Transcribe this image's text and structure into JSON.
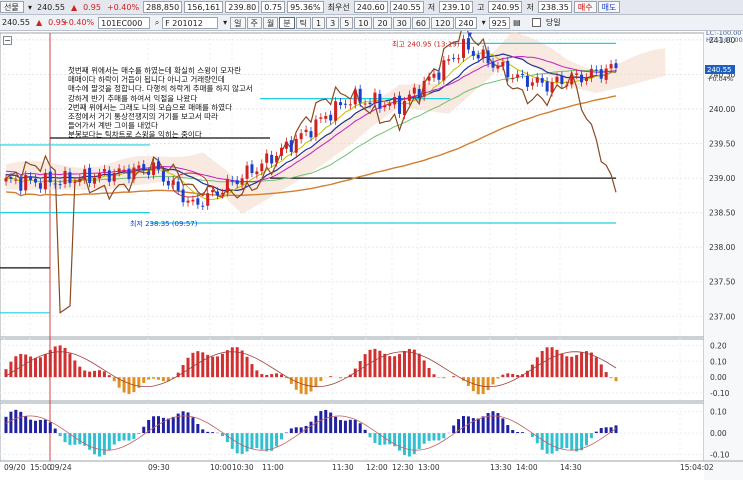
{
  "toolbar1": {
    "mode": "선물",
    "price": "240.55",
    "change_arrow": "▲",
    "change": "0.95",
    "change_pct": "+0.40%",
    "prev_close": "288,850",
    "volume": "156,161",
    "value1": "239.80",
    "value2": "0.75",
    "value3": "95.36%",
    "label_best": "최우선",
    "bid": "240.60",
    "ask": "240.55",
    "label_low": "저",
    "low": "239.10",
    "label_high": "고",
    "high": "240.95",
    "label_open": "저",
    "open": "238.35",
    "buy_btn": "매수",
    "sell_btn": "매도"
  },
  "toolbar2": {
    "code": "101EC000",
    "contract": "F 201012",
    "periods": [
      "일",
      "주",
      "월",
      "분",
      "틱"
    ],
    "active_period": "분",
    "intervals": [
      "1",
      "3",
      "5",
      "10",
      "20",
      "30",
      "60",
      "120"
    ],
    "interval_value": "240",
    "count_value": "925",
    "checkbox_label": "당일"
  },
  "left_box": {
    "price": "240.55",
    "arrow": "▲",
    "change": "0.95",
    "pct": "+0.40%"
  },
  "annotation_lines": [
    "첫번째 위에서는 매수를 하였는데 확실히 스윙이 모자란",
    "매매이다 하락이 거듭이 됩니다 아니고 거래량인데",
    "매수에 팔것을 정합니다. 다행히 하락게 추매를 하지 않고서",
    "강하게 반기 추매를 하여서 익절을 나왔다",
    "2번째 위에서는 그래도 나의 모습으로 매매를 하였다",
    "조정에서 거기 통상전쟁지의 거기를 보고서 따라",
    "들어가서 계반 그이를 내었다",
    "분봉보다는 틱차트로 스윙을 익히는 중이다"
  ],
  "chart_data": {
    "type": "candlestick",
    "price_axis": {
      "range": [
        236.7,
        241.1
      ],
      "ticks": [
        "241.00",
        "240.50",
        "240.00",
        "239.50",
        "239.00",
        "238.50",
        "238.00",
        "237.50",
        "237.00"
      ],
      "current_price": "240.55",
      "current_pct": "+0.04%"
    },
    "top_right_labels": [
      "LC:-100.00",
      "HC:-100.00"
    ],
    "time_axis": {
      "labels": [
        "09/20",
        "15:00",
        "09/24",
        "09:30",
        "10:00",
        "10:30",
        "11:00",
        "11:30",
        "12:00",
        "12:30",
        "13:00",
        "13:30",
        "14:00",
        "14:30",
        "15:04:02"
      ]
    },
    "annotations": [
      {
        "text": "최고 240.95 (13:19)"
      },
      {
        "text": "최저 238.35 (09:57)"
      }
    ],
    "indicator1": {
      "ticks": [
        "0.20",
        "0.10",
        "0.00",
        "-0.10"
      ],
      "range": [
        -0.15,
        0.24
      ]
    },
    "indicator2": {
      "ticks": [
        "0.10",
        "0.00",
        "-0.10"
      ],
      "range": [
        -0.13,
        0.14
      ]
    }
  }
}
